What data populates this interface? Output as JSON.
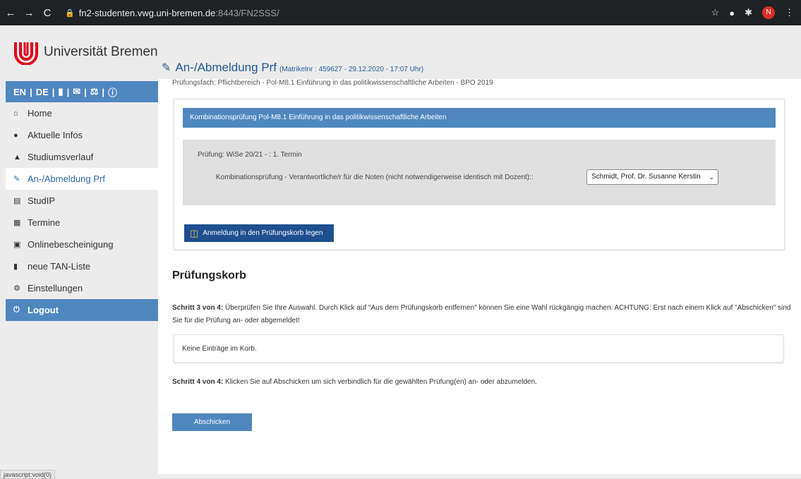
{
  "browser": {
    "back": "←",
    "forward": "→",
    "reload": "C",
    "url_host": "fn2-studenten.vwg.uni-bremen.de",
    "url_rest": ":8443/FN2SSS/",
    "avatar_letter": "N"
  },
  "logo": {
    "text": "Universität Bremen",
    "color": "#e2001a"
  },
  "heading": {
    "title": "An-/Abmeldung Prf",
    "meta": "(Matrikelnr : 459627 - 29.12.2020 - 17:07 Uhr)"
  },
  "sidebar": {
    "lang_en": "EN",
    "lang_de": "DE",
    "items": [
      {
        "label": "Home",
        "icon": "home-icon"
      },
      {
        "label": "Aktuelle Infos",
        "icon": "comment-icon"
      },
      {
        "label": "Studiumsverlauf",
        "icon": "graduation-cap-icon"
      },
      {
        "label": "An-/Abmeldung Prf",
        "icon": "edit-icon"
      },
      {
        "label": "StudIP",
        "icon": "institution-icon"
      },
      {
        "label": "Termine",
        "icon": "calendar-icon"
      },
      {
        "label": "Onlinebescheinigung",
        "icon": "certificate-icon"
      },
      {
        "label": "neue TAN-Liste",
        "icon": "file-icon"
      },
      {
        "label": "Einstellungen",
        "icon": "gear-icon"
      }
    ],
    "logout": "Logout"
  },
  "main": {
    "fach": "Prüfungsfach: Pflichtbereich - Pol-M8.1 Einführung in das politikwissenschaftliche Arbeiten - BPO 2019",
    "card_header": "Kombinationsprüfung Pol-M8.1 Einführung in das politikwissenschaftliche Arbeiten",
    "pruefung": "Prüfung: WiSe 20/21 - : 1. Termin",
    "kombi_label": "Kombinationsprüfung   -   Verantwortliche/r für die Noten (nicht notwendigerweise identisch mit Dozent)::",
    "select_value": "Schmidt, Prof. Dr. Susanne Kerstin",
    "basket_button": "Anmeldung in den Prüfungskorb legen",
    "korb_title": "Prüfungskorb",
    "step3_label": "Schritt 3 von 4:",
    "step3_text": " Überprüfen Sie Ihre Auswahl. Durch Klick auf \"Aus dem Prüfungskorb entfernen\" können Sie eine Wahl rückgängig machen. ACHTUNG: Erst nach einem Klick auf \"Abschicken\" sind Sie für die Prüfung an- oder abgemeldet!",
    "empty_text": "Keine Einträge im Korb.",
    "step4_label": "Schritt 4 von 4:",
    "step4_text": " Klicken Sie auf Abschicken um sich verbindlich für die gewählten Prüfung(en) an- oder abzumelden.",
    "submit_button": "Abschicken"
  },
  "status_tip": "javascript:void(0)",
  "colors": {
    "accent": "#4f87bf",
    "dark_button": "#1e4f8f",
    "link_blue": "#1f5a96"
  }
}
